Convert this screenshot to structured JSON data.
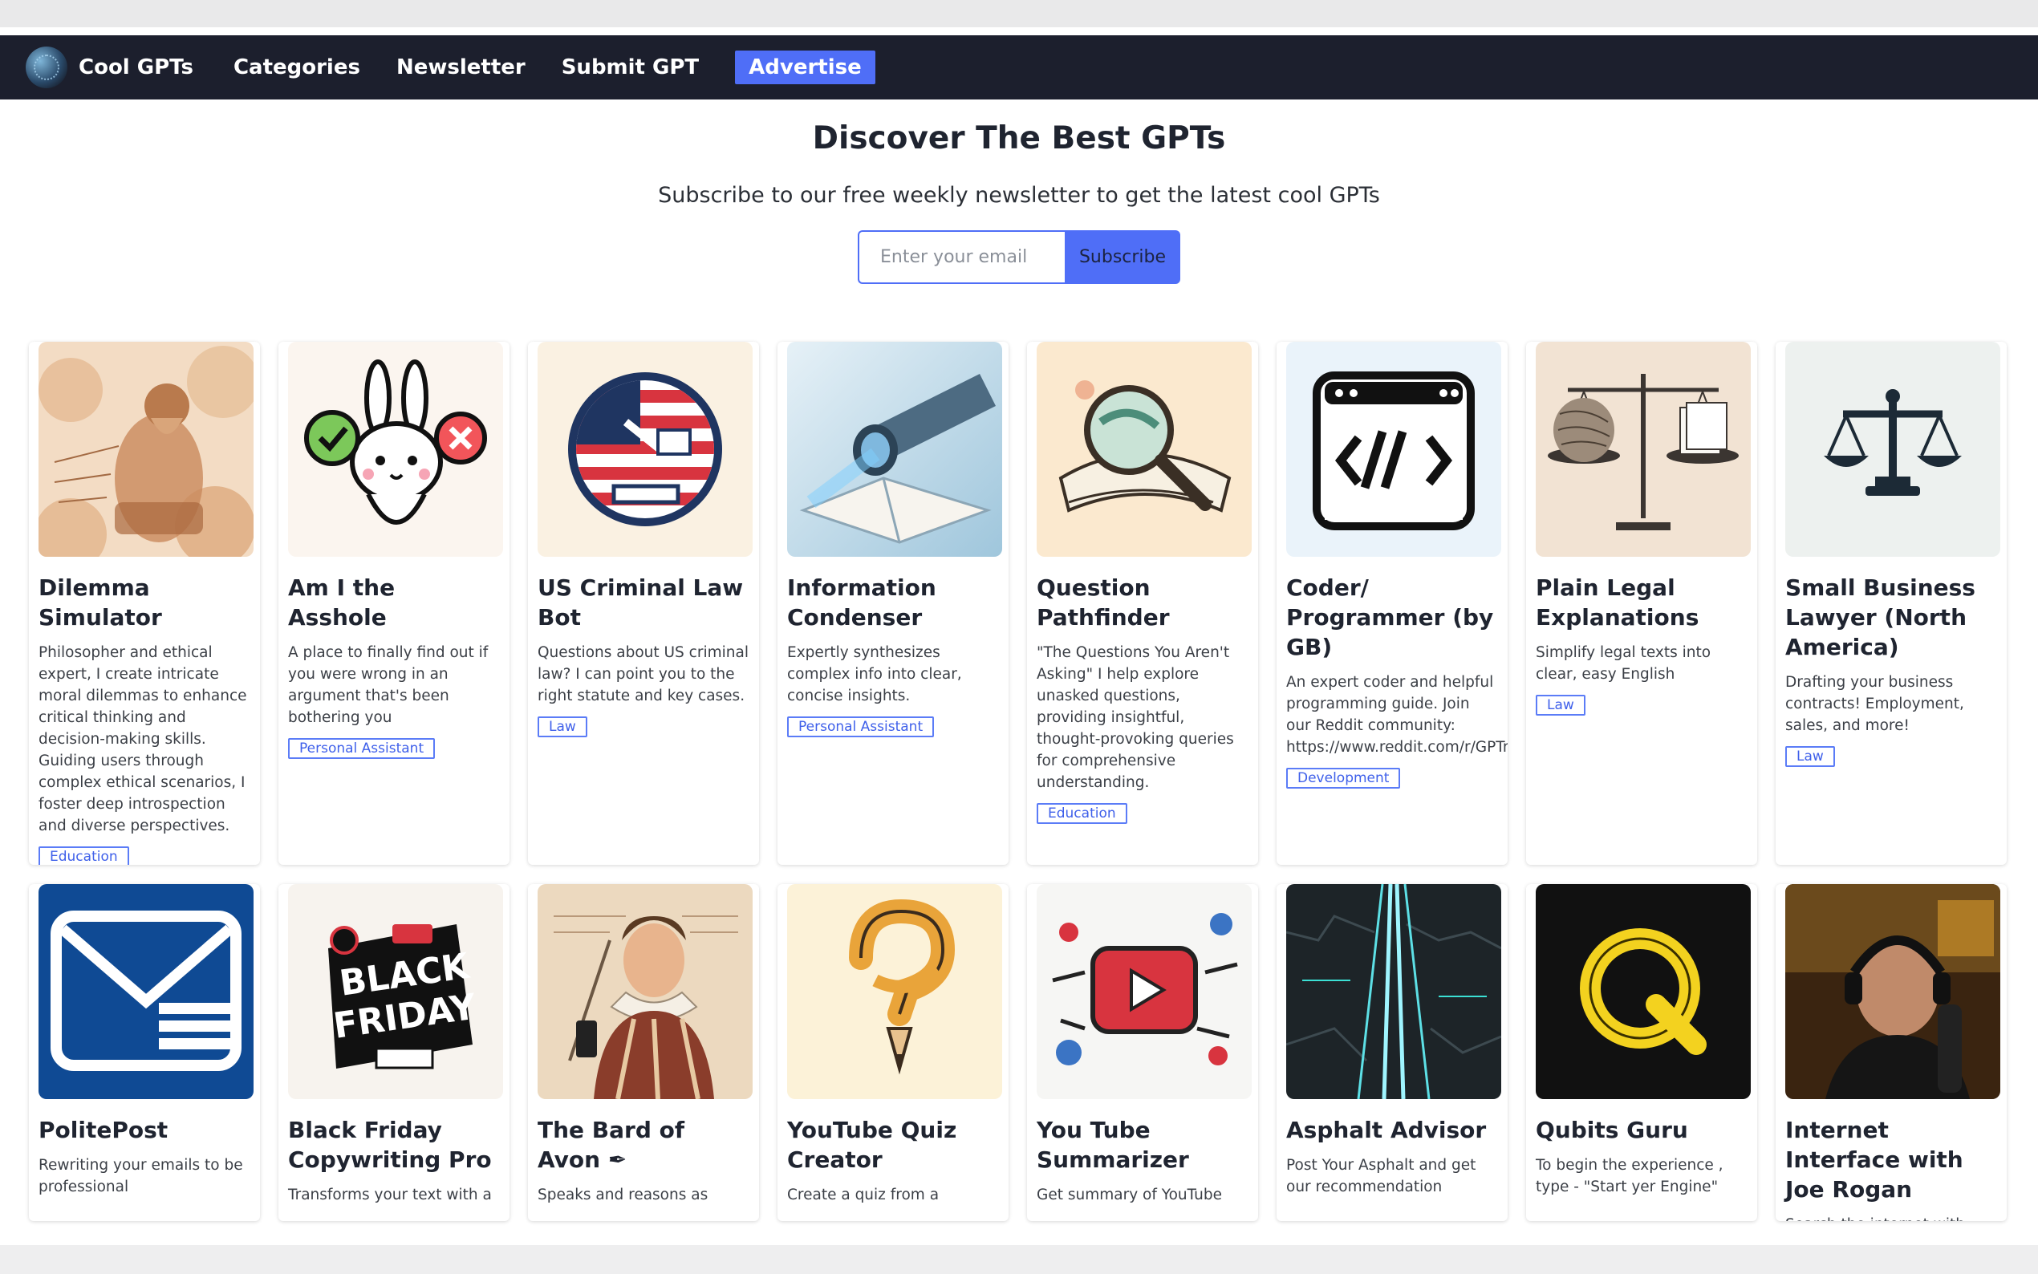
{
  "nav": {
    "brand": "Cool GPTs",
    "links": [
      "Categories",
      "Newsletter",
      "Submit GPT"
    ],
    "advertise": "Advertise"
  },
  "hero": {
    "title": "Discover The Best GPTs",
    "subtitle": "Subscribe to our free weekly newsletter to get the latest cool GPTs",
    "email_placeholder": "Enter your email",
    "subscribe_label": "Subscribe"
  },
  "colors": {
    "nav_bg": "#1c1f2d",
    "accent": "#4f6ef7"
  },
  "cards": [
    {
      "name": "Dilemma Simulator",
      "desc": "Philosopher and ethical expert, I create intricate moral dilemmas to enhance critical thinking and decision-making skills. Guiding users through complex ethical scenarios, I foster deep introspection and diverse perspectives.",
      "tag": "Education",
      "icon": "philosopher-sketch-icon"
    },
    {
      "name": "Am I the Asshole",
      "desc": "A place to finally find out if you were wrong in an argument that's been bothering you",
      "tag": "Personal Assistant",
      "icon": "bunny-check-cross-icon"
    },
    {
      "name": "US Criminal Law Bot",
      "desc": "Questions about US criminal law? I can point you to the right statute and key cases.",
      "tag": "Law",
      "icon": "us-law-emblem-icon"
    },
    {
      "name": "Information Condenser",
      "desc": "Expertly synthesizes complex info into clear, concise insights.",
      "tag": "Personal Assistant",
      "icon": "telescope-book-icon"
    },
    {
      "name": "Question Pathfinder",
      "desc": "\"The Questions You Aren't Asking\" I help explore unasked questions, providing insightful, thought-provoking queries for comprehensive understanding.",
      "tag": "Education",
      "icon": "magnifier-book-icon"
    },
    {
      "name": "Coder/ Programmer (by GB)",
      "desc": "An expert coder and helpful programming guide. Join our Reddit community: https://www.reddit.com/r/GPTreview/",
      "tag": "Development",
      "icon": "code-window-icon"
    },
    {
      "name": "Plain Legal Explanations",
      "desc": "Simplify legal texts into clear, easy English",
      "tag": "Law",
      "icon": "balance-scale-papers-icon"
    },
    {
      "name": "Small Business Lawyer (North America)",
      "desc": "Drafting your business contracts! Employment, sales, and more!",
      "tag": "Law",
      "icon": "scales-of-justice-icon"
    },
    {
      "name": "PolitePost",
      "desc": "Rewriting your emails to be professional",
      "tag": "",
      "icon": "envelope-icon"
    },
    {
      "name": "Black Friday Copywriting Pro",
      "desc": "Transforms your text with a",
      "tag": "",
      "icon": "black-friday-badge-icon"
    },
    {
      "name": "The Bard of Avon ✒",
      "desc": "Speaks and reasons as",
      "tag": "",
      "icon": "shakespeare-portrait-icon"
    },
    {
      "name": "YouTube Quiz Creator",
      "desc": "Create a quiz from a",
      "tag": "",
      "icon": "question-mark-pencil-icon"
    },
    {
      "name": "You Tube Summarizer",
      "desc": "Get summary of YouTube",
      "tag": "",
      "icon": "youtube-play-icon"
    },
    {
      "name": "Asphalt Advisor",
      "desc": "Post Your Asphalt and get our recommendation",
      "tag": "",
      "icon": "neon-road-icon"
    },
    {
      "name": "Qubits Guru",
      "desc": "To begin the experience , type - \"Start yer Engine\"",
      "tag": "",
      "icon": "neon-q-icon"
    },
    {
      "name": "Internet Interface with Joe Rogan",
      "desc": "Search the internet with",
      "tag": "",
      "icon": "podcast-host-photo-icon"
    }
  ]
}
